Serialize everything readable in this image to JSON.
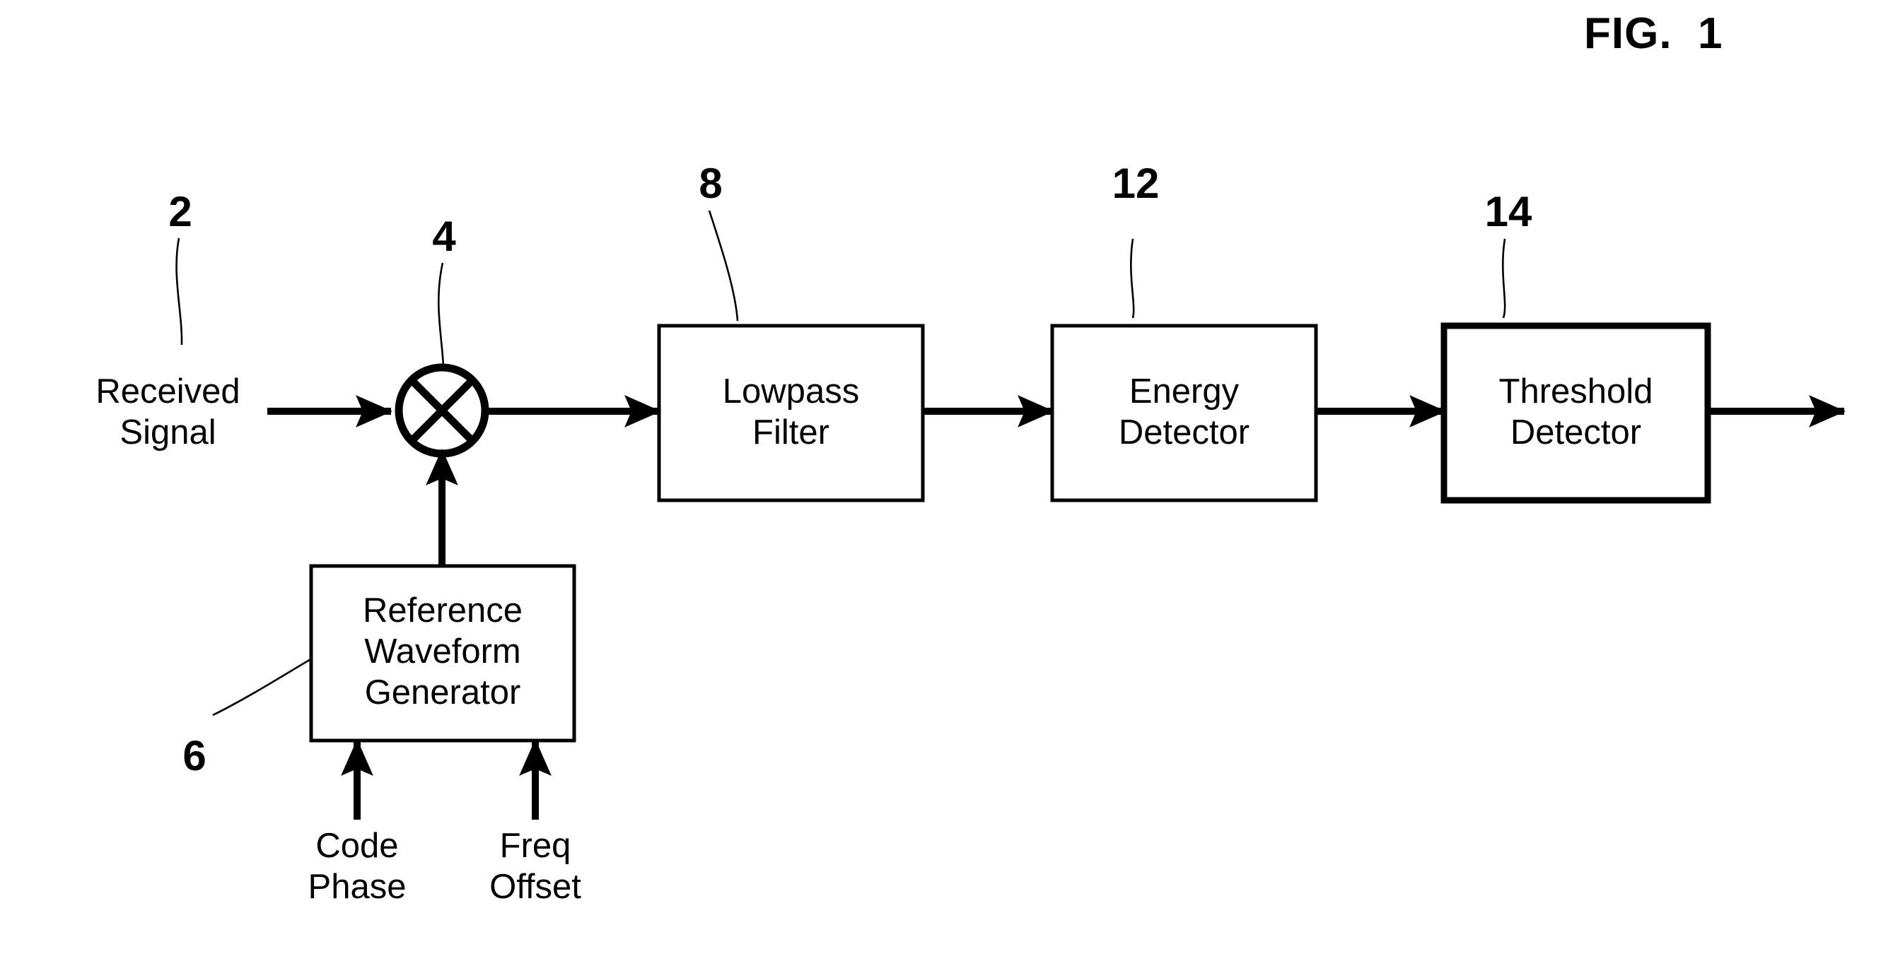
{
  "figure": {
    "title": "FIG.  1",
    "background_color": "#ffffff",
    "line_color": "#000000"
  },
  "reference_numerals": [
    {
      "id": "ref-2",
      "label": "2",
      "points_to": "received-signal-input"
    },
    {
      "id": "ref-4",
      "label": "4",
      "points_to": "mixer"
    },
    {
      "id": "ref-6",
      "label": "6",
      "points_to": "reference-waveform-generator"
    },
    {
      "id": "ref-8",
      "label": "8",
      "points_to": "lowpass-filter"
    },
    {
      "id": "ref-12",
      "label": "12",
      "points_to": "energy-detector"
    },
    {
      "id": "ref-14",
      "label": "14",
      "points_to": "threshold-detector"
    }
  ],
  "blocks": [
    {
      "id": "lowpass-filter",
      "label": "Lowpass\nFilter",
      "border_width": 5
    },
    {
      "id": "energy-detector",
      "label": "Energy\nDetector",
      "border_width": 5
    },
    {
      "id": "threshold-detector",
      "label": "Threshold\nDetector",
      "border_width": 9
    },
    {
      "id": "reference-waveform-generator",
      "label": "Reference\nWaveform\nGenerator",
      "border_width": 5
    }
  ],
  "mixer": {
    "id": "mixer",
    "symbol": "circle-with-x",
    "description": "multiplier"
  },
  "io_labels": [
    {
      "id": "received-signal",
      "label": "Received\nSignal"
    },
    {
      "id": "code-phase",
      "label": "Code\nPhase"
    },
    {
      "id": "freq-offset",
      "label": "Freq\nOffset"
    }
  ],
  "connections": [
    {
      "from": "received-signal",
      "to": "mixer",
      "direction": "right"
    },
    {
      "from": "mixer",
      "to": "lowpass-filter",
      "direction": "right"
    },
    {
      "from": "lowpass-filter",
      "to": "energy-detector",
      "direction": "right"
    },
    {
      "from": "energy-detector",
      "to": "threshold-detector",
      "direction": "right"
    },
    {
      "from": "threshold-detector",
      "to": "output",
      "direction": "right"
    },
    {
      "from": "reference-waveform-generator",
      "to": "mixer",
      "direction": "up"
    },
    {
      "from": "code-phase",
      "to": "reference-waveform-generator",
      "direction": "up"
    },
    {
      "from": "freq-offset",
      "to": "reference-waveform-generator",
      "direction": "up"
    }
  ]
}
